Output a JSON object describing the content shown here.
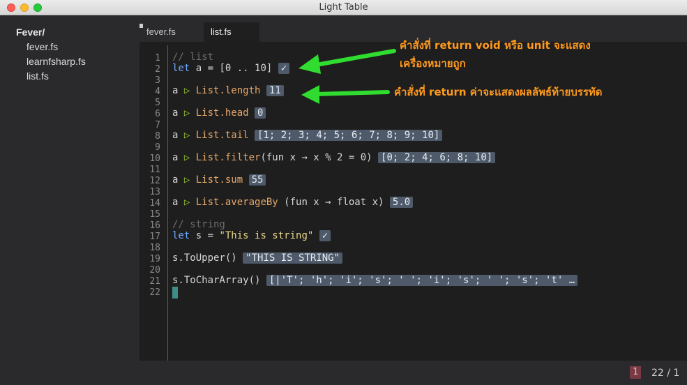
{
  "window": {
    "title": "Light Table"
  },
  "sidebar": {
    "folder": "Fever/",
    "files": [
      "fever.fs",
      "learnfsharp.fs",
      "list.fs"
    ]
  },
  "tabs": [
    {
      "label": "fever.fs",
      "active": false
    },
    {
      "label": "list.fs",
      "active": true
    }
  ],
  "editor": {
    "line_numbers": [
      "1",
      "2",
      "3",
      "4",
      "5",
      "6",
      "7",
      "8",
      "9",
      "10",
      "11",
      "12",
      "13",
      "14",
      "15",
      "16",
      "17",
      "18",
      "19",
      "20",
      "21",
      "22"
    ],
    "lines": {
      "l1": "// list",
      "l2_kw": "let",
      "l2_code": " a = [0 .. 10]",
      "l2_result": "✓",
      "l4_a": "a ",
      "l4_arrow": "▷",
      "l4_fn": " List.length",
      "l4_result": "11",
      "l6_fn": " List.head",
      "l6_result": "0",
      "l8_fn": " List.tail",
      "l8_result": "[1; 2; 3; 4; 5; 6; 7; 8; 9; 10]",
      "l10_fn": " List.filter",
      "l10_code": "(fun x → x % 2 = 0)",
      "l10_result": "[0; 2; 4; 6; 8; 10]",
      "l12_fn": " List.sum",
      "l12_result": "55",
      "l14_fn": " List.averageBy",
      "l14_code": " (fun x → float x)",
      "l14_result": "5.0",
      "l16": "// string",
      "l17_kw": "let",
      "l17_code": " s = ",
      "l17_str": "\"This is string\"",
      "l17_result": "✓",
      "l19_code": "s.ToUpper()",
      "l19_result": "\"THIS IS STRING\"",
      "l21_code": "s.ToCharArray()",
      "l21_result": "[|'T'; 'h'; 'i'; 's'; ' '; 'i'; 's'; ' '; 's'; 't' …"
    }
  },
  "annotations": {
    "first_line1": "คำสั่งที่ return void หรือ unit จะแสดง",
    "first_line2": "เครื่องหมายถูก",
    "second": "คำสั่งที่ return ค่าจะแสดงผลลัพธ์ท้ายบรรทัด",
    "arrow_color": "#2fdc2f"
  },
  "status": {
    "error_count": "1",
    "position": "22 / 1"
  },
  "colors": {
    "accent_orange": "#ff9a1e",
    "result_bg": "#4e5a6a"
  }
}
